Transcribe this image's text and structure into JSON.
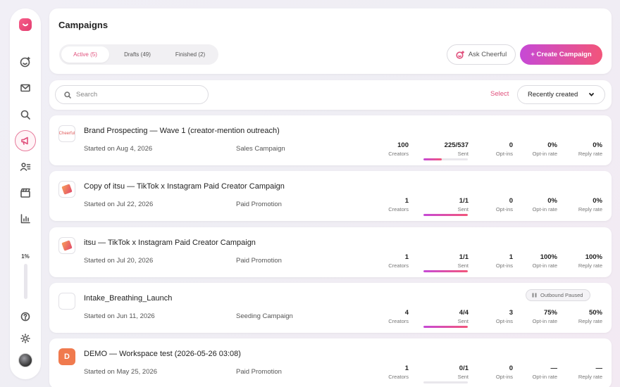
{
  "sidebar": {
    "usage_percent_label": "1%",
    "items": [
      {
        "icon": "logo-icon"
      },
      {
        "icon": "smiley-plus-icon"
      },
      {
        "icon": "mail-icon"
      },
      {
        "icon": "search-icon"
      },
      {
        "icon": "megaphone-icon",
        "active": true
      },
      {
        "icon": "contacts-list-icon"
      },
      {
        "icon": "clapperboard-icon"
      },
      {
        "icon": "bar-chart-icon"
      },
      {
        "icon": "help-icon"
      },
      {
        "icon": "sun-icon"
      }
    ]
  },
  "header": {
    "title": "Campaigns",
    "tabs": [
      {
        "label": "Active (5)",
        "active": true
      },
      {
        "label": "Drafts (49)",
        "active": false
      },
      {
        "label": "Finished (2)",
        "active": false
      }
    ],
    "ask_label": "Ask Cheerful",
    "create_label": "+ Create Campaign"
  },
  "toolbar": {
    "search_placeholder": "Search",
    "select_label": "Select",
    "sort_label": "Recently created"
  },
  "campaigns": [
    {
      "title": "Brand Prospecting — Wave 1 (creator-mention outreach)",
      "started": "Started on Aug 4, 2026",
      "type": "Sales Campaign",
      "thumb": "Cheerful",
      "badge": "",
      "creators": "100",
      "sent": "225/537",
      "optins": "0",
      "optin_rate": "0%",
      "reply_rate": "0%",
      "sent_progress": 0.42
    },
    {
      "title": "Copy of itsu — TikTok x Instagram Paid Creator Campaign",
      "started": "Started on Jul 22, 2026",
      "type": "Paid Promotion",
      "thumb": "",
      "badge": "",
      "creators": "1",
      "sent": "1/1",
      "optins": "0",
      "optin_rate": "0%",
      "reply_rate": "0%",
      "sent_progress": 1.0
    },
    {
      "title": "itsu — TikTok x Instagram Paid Creator Campaign",
      "started": "Started on Jul 20, 2026",
      "type": "Paid Promotion",
      "thumb": "",
      "badge": "",
      "creators": "1",
      "sent": "1/1",
      "optins": "1",
      "optin_rate": "100%",
      "reply_rate": "100%",
      "sent_progress": 1.0
    },
    {
      "title": "Intake_Breathing_Launch",
      "started": "Started on Jun 11, 2026",
      "type": "Seeding Campaign",
      "thumb": "",
      "badge": "Outbound Paused",
      "creators": "4",
      "sent": "4/4",
      "optins": "3",
      "optin_rate": "75%",
      "reply_rate": "50%",
      "sent_progress": 1.0
    },
    {
      "title": "DEMO — Workspace test (2026-05-26 03:08)",
      "started": "Started on May 25, 2026",
      "type": "Paid Promotion",
      "thumb": "D",
      "badge": "",
      "creators": "1",
      "sent": "0/1",
      "optins": "0",
      "optin_rate": "—",
      "reply_rate": "—",
      "sent_progress": 0.0
    }
  ],
  "metric_labels": {
    "creators": "Creators",
    "sent": "Sent",
    "optins": "Opt-ins",
    "optin_rate": "Opt-in rate",
    "reply_rate": "Reply rate"
  }
}
